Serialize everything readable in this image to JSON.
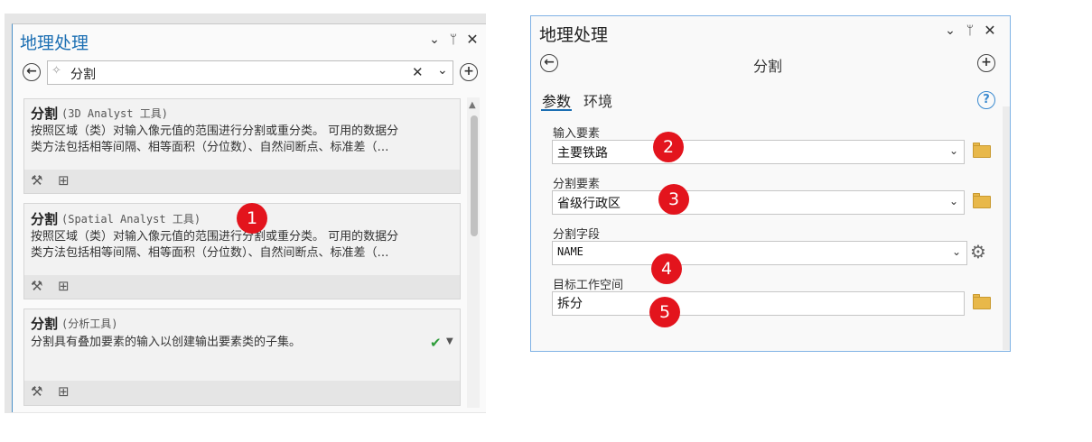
{
  "left_panel": {
    "title": "地理处理",
    "search_value": "分割",
    "header_icons": {
      "menu": "chevron-down-icon",
      "pin": "pin-icon",
      "close": "close-icon"
    },
    "results": [
      {
        "title": "分割",
        "toolbox": "(3D Analyst 工具)",
        "desc_line1": "按照区域（类）对输入像元值的范围进行分割或重分类。 可用的数据分",
        "desc_line2": "类方法包括相等间隔、相等面积（分位数）、自然间断点、标准差（…"
      },
      {
        "title": "分割",
        "toolbox": "(Spatial Analyst 工具)",
        "desc_line1": "按照区域（类）对输入像元值的范围进行分割或重分类。 可用的数据分",
        "desc_line2": "类方法包括相等间隔、相等面积（分位数）、自然间断点、标准差（…"
      },
      {
        "title": "分割",
        "toolbox": "(分析工具)",
        "desc_line1": "分割具有叠加要素的输入以创建输出要素类的子集。",
        "desc_line2": ""
      }
    ]
  },
  "right_panel": {
    "title": "地理处理",
    "tool_name": "分割",
    "tabs": {
      "params": "参数",
      "env": "环境"
    },
    "help": "?",
    "fields": [
      {
        "label": "输入要素",
        "value": "主要铁路"
      },
      {
        "label": "分割要素",
        "value": "省级行政区"
      },
      {
        "label": "分割字段",
        "value": "NAME"
      },
      {
        "label": "目标工作空间",
        "value": "拆分"
      }
    ]
  },
  "markers": [
    "1",
    "2",
    "3",
    "4",
    "5"
  ],
  "colors": {
    "accent": "#1c6fb3",
    "marker": "#e3141d",
    "check": "#2e9d3a",
    "folder": "#e8b84a"
  }
}
